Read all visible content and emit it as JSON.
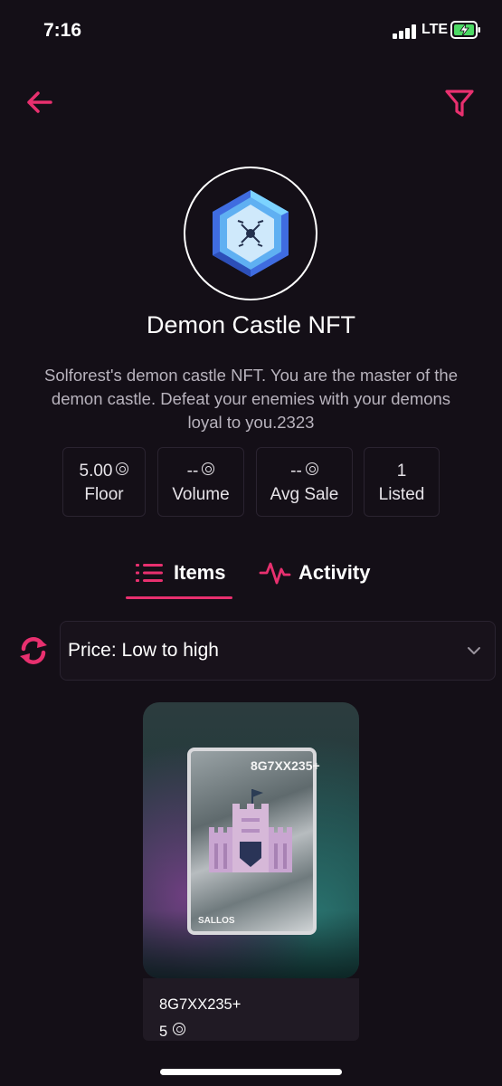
{
  "status_bar": {
    "time": "7:16",
    "network": "LTE"
  },
  "colors": {
    "background": "#140f17",
    "accent": "#e8306f",
    "text": "#ffffff",
    "muted": "#b8b3bd"
  },
  "nav": {
    "back_icon": "arrow-left-icon",
    "filter_icon": "filter-icon"
  },
  "collection": {
    "title": "Demon Castle NFT",
    "description": "Solforest's demon castle NFT. You are the master of the demon castle. Defeat your enemies with your demons loyal to you.2323",
    "avatar_icon": "hexagon-gem-icon"
  },
  "stats": [
    {
      "value": "5.00",
      "label": "Floor",
      "coin_icon": "solana-coin-icon"
    },
    {
      "value": "--",
      "label": "Volume",
      "coin_icon": "solana-coin-icon"
    },
    {
      "value": "--",
      "label": "Avg Sale",
      "coin_icon": "solana-coin-icon"
    },
    {
      "value": "1",
      "label": "Listed"
    }
  ],
  "tabs": [
    {
      "label": "Items",
      "icon": "list-icon",
      "active": true
    },
    {
      "label": "Activity",
      "icon": "activity-pulse-icon",
      "active": false
    }
  ],
  "sort": {
    "refresh_icon": "refresh-icon",
    "selected": "Price: Low to high",
    "chevron_icon": "chevron-down-icon"
  },
  "items": [
    {
      "overlay_id": "8G7XX235+",
      "overlay_footer": "SALLOS",
      "name": "8G7XX235+",
      "price": "5"
    }
  ]
}
